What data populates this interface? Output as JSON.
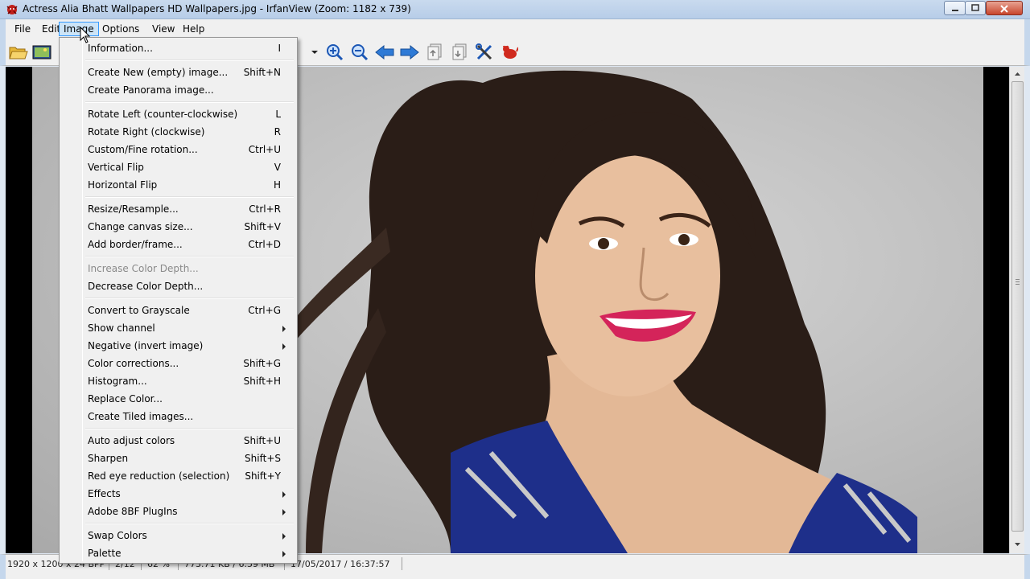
{
  "window": {
    "title": "Actress Alia Bhatt Wallpapers  HD Wallpapers.jpg - IrfanView (Zoom: 1182 x 739)",
    "app_icon": "irfanview-red-cat-icon"
  },
  "menubar": {
    "items": [
      {
        "label": "File"
      },
      {
        "label": "Edit"
      },
      {
        "label": "Image",
        "active": true
      },
      {
        "label": "Options"
      },
      {
        "label": "View"
      },
      {
        "label": "Help"
      }
    ]
  },
  "toolbar": {
    "icons": [
      "open-folder-icon",
      "slideshow-icon",
      "combo-dropdown-icon",
      "zoom-in-icon",
      "zoom-out-icon",
      "previous-arrow-icon",
      "next-arrow-icon",
      "copy-page-icon",
      "paste-page-icon",
      "tools-icon",
      "irfanview-cat-icon"
    ]
  },
  "image_menu": {
    "items": [
      {
        "label": "Information...",
        "shortcut": "I"
      },
      {
        "label": "Create New (empty) image...",
        "shortcut": "Shift+N"
      },
      {
        "label": "Create Panorama image...",
        "shortcut": ""
      },
      {
        "label": "Rotate Left (counter-clockwise)",
        "shortcut": "L"
      },
      {
        "label": "Rotate Right (clockwise)",
        "shortcut": "R"
      },
      {
        "label": "Custom/Fine rotation...",
        "shortcut": "Ctrl+U"
      },
      {
        "label": "Vertical Flip",
        "shortcut": "V"
      },
      {
        "label": "Horizontal Flip",
        "shortcut": "H"
      },
      {
        "label": "Resize/Resample...",
        "shortcut": "Ctrl+R"
      },
      {
        "label": "Change canvas size...",
        "shortcut": "Shift+V"
      },
      {
        "label": "Add border/frame...",
        "shortcut": "Ctrl+D"
      },
      {
        "label": "Increase Color Depth...",
        "shortcut": "",
        "disabled": true
      },
      {
        "label": "Decrease Color Depth...",
        "shortcut": ""
      },
      {
        "label": "Convert to Grayscale",
        "shortcut": "Ctrl+G"
      },
      {
        "label": "Show channel",
        "shortcut": "",
        "submenu": true
      },
      {
        "label": "Negative (invert image)",
        "shortcut": "",
        "submenu": true
      },
      {
        "label": "Color corrections...",
        "shortcut": "Shift+G"
      },
      {
        "label": "Histogram...",
        "shortcut": "Shift+H"
      },
      {
        "label": "Replace Color...",
        "shortcut": ""
      },
      {
        "label": "Create Tiled images...",
        "shortcut": ""
      },
      {
        "label": "Auto adjust colors",
        "shortcut": "Shift+U"
      },
      {
        "label": "Sharpen",
        "shortcut": "Shift+S"
      },
      {
        "label": "Red eye reduction (selection)",
        "shortcut": "Shift+Y"
      },
      {
        "label": "Effects",
        "shortcut": "",
        "submenu": true
      },
      {
        "label": "Adobe 8BF PlugIns",
        "shortcut": "",
        "submenu": true
      },
      {
        "label": "Swap Colors",
        "shortcut": "",
        "submenu": true
      },
      {
        "label": "Palette",
        "shortcut": "",
        "submenu": true
      }
    ]
  },
  "statusbar": {
    "dimensions": "1920 x 1200 x 24 BPP",
    "index": "2/12",
    "zoom": "62 %",
    "size": "773.71 KB / 6.59 MB",
    "datetime": "17/05/2017 / 16:37:57"
  },
  "colors": {
    "titlebar": "#c9daee",
    "menu_bg": "#f0f0f0",
    "active_menu": "#cce4f7",
    "dress_blue": "#1e2f8a"
  }
}
